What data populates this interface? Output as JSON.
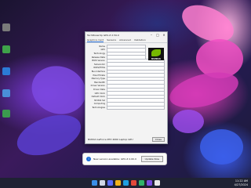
{
  "window": {
    "title": "TechPowerUp GPU-Z 2.59.0",
    "tabs": [
      "Graphics Card",
      "Sensors",
      "Advanced",
      "Validation"
    ],
    "rows": [
      "Name",
      "GPU",
      "Technology",
      "Release Date",
      "BIOS Version",
      "Subvendor",
      "ROPs/TMUs",
      "Bus Interface",
      "Pixel Fillrate",
      "Memory Type",
      "Bandwidth",
      "Driver Version",
      "Driver Date",
      "GPU Clock",
      "Default Clock",
      "NVIDIA SLI",
      "Computing",
      "Technologies"
    ],
    "device_select": "NVIDIA GeForce RTX 4060 Laptop GPU",
    "close_label": "Close",
    "logo_text": "NVIDIA"
  },
  "notification": {
    "message": "New version available: GPU-Z 2.60.0",
    "button": "Update Now"
  },
  "taskbar": {
    "time": "11:22 AM",
    "date": "4/27/2024"
  },
  "colors": {
    "accent": "#76b900",
    "taskbar": "#1f2233"
  }
}
